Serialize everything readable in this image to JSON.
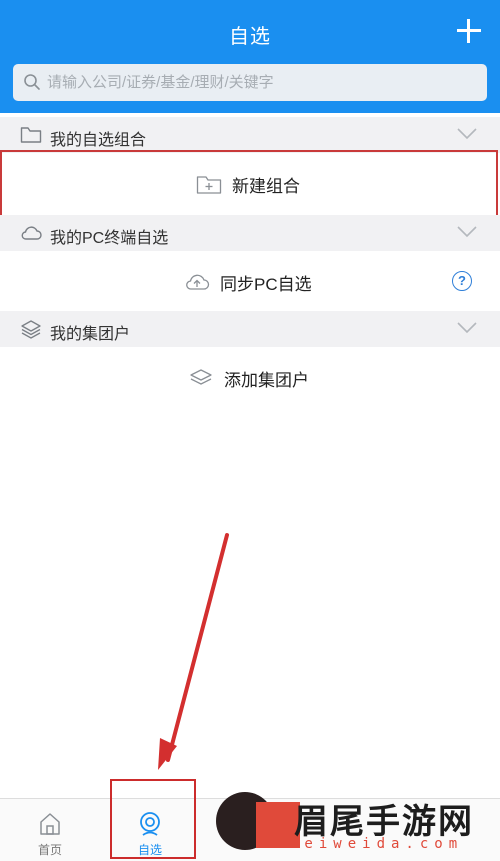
{
  "header": {
    "title": "自选",
    "add_icon": "plus-icon",
    "search": {
      "placeholder": "请输入公司/证券/基金/理财/关键字",
      "icon": "search-icon"
    }
  },
  "sections": [
    {
      "id": "my-portfolio",
      "title": "我的自选组合",
      "icon": "folder-icon",
      "action_label": "新建组合",
      "action_icon": "folder-plus-icon"
    },
    {
      "id": "pc-terminal",
      "title": "我的PC终端自选",
      "icon": "cloud-icon",
      "action_label": "同步PC自选",
      "action_icon": "cloud-upload-icon",
      "help_mark": "?"
    },
    {
      "id": "group",
      "title": "我的集团户",
      "icon": "layers-icon",
      "action_label": "添加集团户",
      "action_icon": "layers-icon"
    }
  ],
  "tabbar": {
    "tabs": [
      {
        "label": "首页",
        "icon": "home-icon",
        "active": false
      },
      {
        "label": "自选",
        "icon": "watchlist-icon",
        "active": true
      }
    ]
  },
  "watermark": {
    "text": "眉尾手游网",
    "sub": "meiweida.com"
  },
  "colors": {
    "brand": "#1a8ff0",
    "annotation_red": "#c93a3a",
    "section_bg": "#f1f1f3"
  }
}
